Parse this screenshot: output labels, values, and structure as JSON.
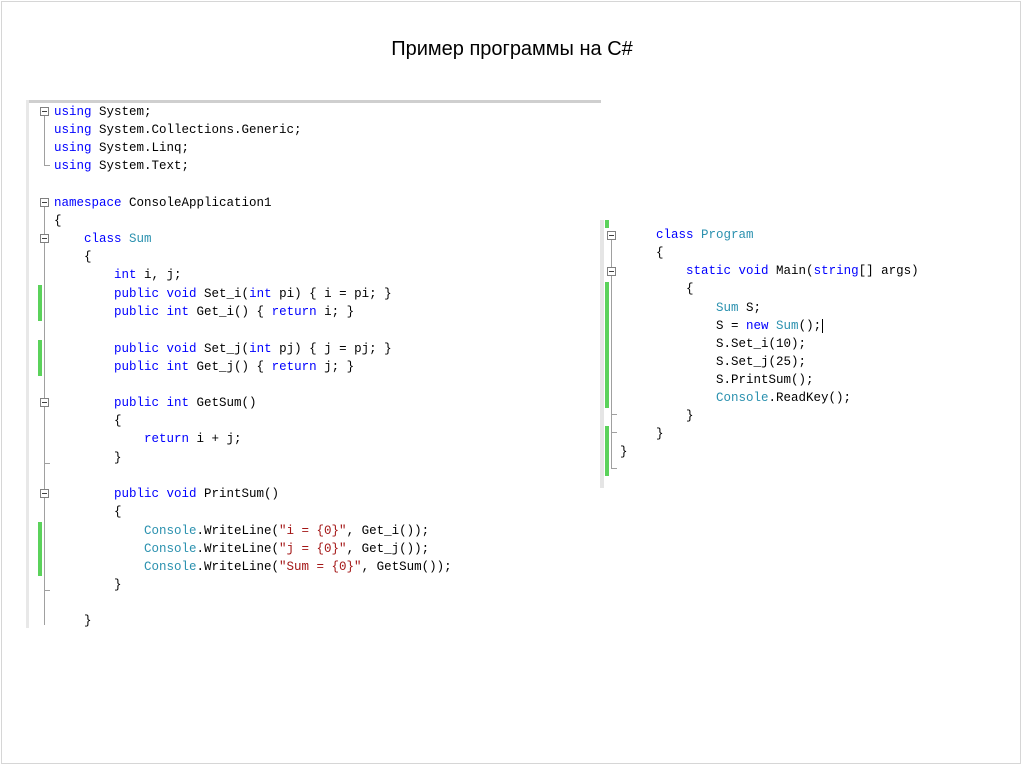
{
  "title": "Пример программы на C#",
  "left_code": {
    "l1": {
      "kw": "using",
      "rest": " System;"
    },
    "l2": {
      "kw": "using",
      "rest": " System.Collections.Generic;"
    },
    "l3": {
      "kw": "using",
      "rest": " System.Linq;"
    },
    "l4": {
      "kw": "using",
      "rest": " System.Text;"
    },
    "l5": {
      "kw": "namespace",
      "rest": " ConsoleApplication1"
    },
    "l6": "{",
    "l7": {
      "indent": "    ",
      "kw": "class",
      "ty": " Sum"
    },
    "l8": "    {",
    "l9": {
      "indent": "        ",
      "kw": "int",
      "rest": " i, j;"
    },
    "l10": {
      "indent": "        ",
      "kw1": "public",
      "kw2": " void",
      "a": " Set_i(",
      "kw3": "int",
      "b": " pi) { i = pi; }"
    },
    "l11": {
      "indent": "        ",
      "kw1": "public",
      "kw2": " int",
      "a": " Get_i() { ",
      "kw3": "return",
      "b": " i; }"
    },
    "l12": {
      "indent": "        ",
      "kw1": "public",
      "kw2": " void",
      "a": " Set_j(",
      "kw3": "int",
      "b": " pj) { j = pj; }"
    },
    "l13": {
      "indent": "        ",
      "kw1": "public",
      "kw2": " int",
      "a": " Get_j() { ",
      "kw3": "return",
      "b": " j; }"
    },
    "l14": {
      "indent": "        ",
      "kw1": "public",
      "kw2": " int",
      "a": " GetSum()"
    },
    "l15": "        {",
    "l16": {
      "indent": "            ",
      "kw": "return",
      "rest": " i + j;"
    },
    "l17": "        }",
    "l18": {
      "indent": "        ",
      "kw1": "public",
      "kw2": " void",
      "a": " PrintSum()"
    },
    "l19": "        {",
    "l20": {
      "indent": "            ",
      "ty": "Console",
      "a": ".WriteLine(",
      "st": "\"i = {0}\"",
      "b": ", Get_i());"
    },
    "l21": {
      "indent": "            ",
      "ty": "Console",
      "a": ".WriteLine(",
      "st": "\"j = {0}\"",
      "b": ", Get_j());"
    },
    "l22": {
      "indent": "            ",
      "ty": "Console",
      "a": ".WriteLine(",
      "st": "\"Sum = {0}\"",
      "b": ", GetSum());"
    },
    "l23": "        }",
    "l24": "    }"
  },
  "right_code": {
    "r1": {
      "kw": "class",
      "ty": " Program"
    },
    "r2": "{",
    "r3": {
      "indent": "    ",
      "kw1": "static",
      "kw2": " void",
      "a": " Main(",
      "kw3": "string",
      "b": "[] args)"
    },
    "r4": "    {",
    "r5": {
      "indent": "        ",
      "ty": "Sum",
      "a": " S;"
    },
    "r6": {
      "indent": "        ",
      "a": "S = ",
      "kw": "new",
      "ty": " Sum",
      "b": "();"
    },
    "r7": "        S.Set_i(10);",
    "r8": "        S.Set_j(25);",
    "r9": "        S.PrintSum();",
    "r10": {
      "indent": "        ",
      "ty": "Console",
      "a": ".ReadKey();"
    },
    "r11": "    }",
    "r12": "}",
    "r13": "}"
  },
  "colors": {
    "keyword": "#0000ff",
    "type": "#2b91af",
    "string": "#a31515",
    "change_bar": "#5bd25b"
  }
}
